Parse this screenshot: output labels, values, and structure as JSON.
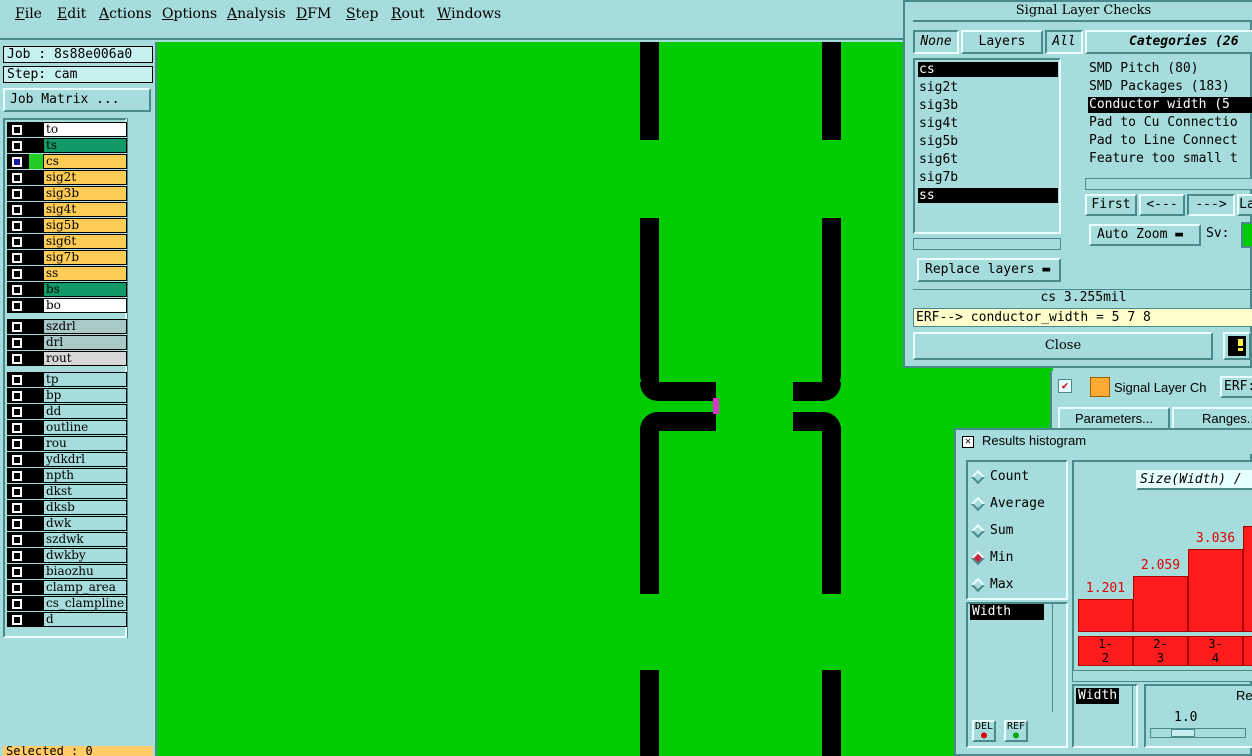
{
  "menu": [
    "File",
    "Edit",
    "Actions",
    "Options",
    "Analysis",
    "DFM",
    "Step",
    "Rout",
    "Windows"
  ],
  "job": {
    "job_label": "Job : 8s88e006a0",
    "step_label": "Step: cam",
    "matrix_button": "Job Matrix ..."
  },
  "layers": [
    {
      "name": "to",
      "color": "#ffffff"
    },
    {
      "name": "ts",
      "color": "#119966"
    },
    {
      "name": "cs",
      "color": "#ffcc55"
    },
    {
      "name": "sig2t",
      "color": "#ffcc55"
    },
    {
      "name": "sig3b",
      "color": "#ffcc55"
    },
    {
      "name": "sig4t",
      "color": "#ffcc55"
    },
    {
      "name": "sig5b",
      "color": "#ffcc55"
    },
    {
      "name": "sig6t",
      "color": "#ffcc55"
    },
    {
      "name": "sig7b",
      "color": "#ffcc55"
    },
    {
      "name": "ss",
      "color": "#ffcc55"
    },
    {
      "name": "bs",
      "color": "#119966"
    },
    {
      "name": "bo",
      "color": "#ffffff"
    }
  ],
  "drill_layers": [
    {
      "name": "szdrl",
      "color": "#a9c8c8"
    },
    {
      "name": "drl",
      "color": "#a9c8c8"
    },
    {
      "name": "rout",
      "color": "#d8d8d8"
    }
  ],
  "misc_layers": [
    {
      "name": "tp"
    },
    {
      "name": "bp"
    },
    {
      "name": "dd"
    },
    {
      "name": "outline"
    },
    {
      "name": "rou"
    },
    {
      "name": "ydkdrl"
    },
    {
      "name": "npth"
    },
    {
      "name": "dkst"
    },
    {
      "name": "dksb"
    },
    {
      "name": "dwk"
    },
    {
      "name": "szdwk"
    },
    {
      "name": "dwkby"
    },
    {
      "name": "biaozhu"
    },
    {
      "name": "clamp_area"
    },
    {
      "name": "cs_clampline"
    },
    {
      "name": "d"
    }
  ],
  "selected_text": "Selected : 0",
  "signal_checks": {
    "title": "Signal Layer Checks",
    "tab_none": "None",
    "tab_layers": "Layers",
    "tab_all": "All",
    "layer_items": [
      "cs",
      "sig2t",
      "sig3b",
      "sig4t",
      "sig5b",
      "sig6t",
      "sig7b",
      "ss"
    ],
    "categories_header": "Categories (26",
    "categories": [
      "SMD Pitch (80)",
      "SMD Packages (183)",
      "Conductor width (5",
      "Pad to Cu Connectio",
      "Pad to Line Connect",
      "Feature too small t"
    ],
    "btn_first": "First",
    "btn_prev": "<---",
    "btn_next": "--->",
    "btn_last": "La",
    "auto_zoom": "Auto Zoom",
    "sv_label": "Sv:",
    "replace_layers": "Replace layers",
    "status": "cs 3.255mil",
    "erf_line": "ERF--> conductor_width = 5 7 8",
    "close": "Close"
  },
  "slc2": {
    "title": "Signal Layer Ch",
    "erf": "ERF:",
    "params": "Parameters...",
    "ranges": "Ranges..."
  },
  "histogram": {
    "title": "Results histogram",
    "modes": [
      "Count",
      "Average",
      "Sum",
      "Min",
      "Max"
    ],
    "selected_mode": "Min",
    "header": "Size(Width) /",
    "list_item": "Width",
    "del": "DEL",
    "ref": "REF",
    "width_label": "Width",
    "re_label": "Re",
    "slider_value": "1.0",
    "bars": [
      {
        "label": "1.201",
        "value": 1.201,
        "bin": [
          "1-",
          "2"
        ]
      },
      {
        "label": "2.059",
        "value": 2.059,
        "bin": [
          "2-",
          "3"
        ]
      },
      {
        "label": "3.036",
        "value": 3.036,
        "bin": [
          "3-",
          "4"
        ]
      },
      {
        "label": "",
        "value": 3.9,
        "bin": [
          "",
          ""
        ]
      }
    ]
  },
  "colors": {
    "canvas": "#00cc00",
    "panel": "#a6dcdc",
    "signal": "#ffcc55",
    "bar": "#ff1c1c"
  }
}
